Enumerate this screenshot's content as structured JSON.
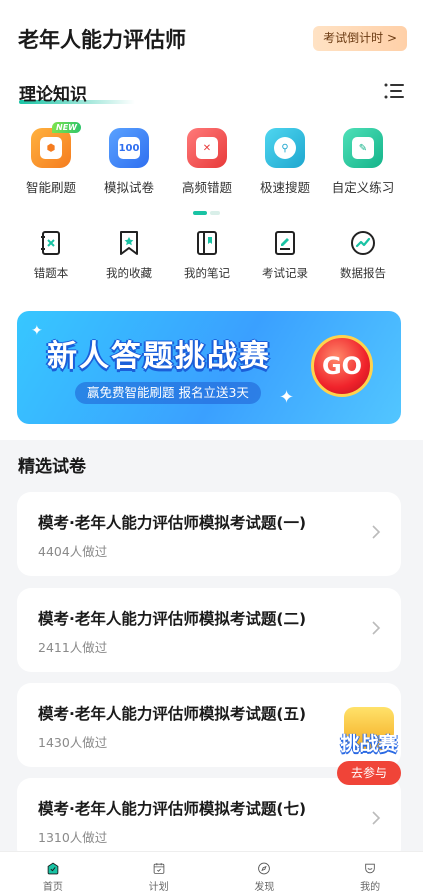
{
  "header": {
    "title": "老年人能力评估师",
    "countdown_label": "考试倒计时 >"
  },
  "theory": {
    "title": "理论知识",
    "main_tools": [
      {
        "label": "智能刷题",
        "icon": "smart-practice-icon",
        "badge": "NEW",
        "color": "#f7931e"
      },
      {
        "label": "模拟试卷",
        "icon": "mock-paper-icon",
        "badge": "100",
        "color": "#3b82f6"
      },
      {
        "label": "高频错题",
        "icon": "frequent-mistakes-icon",
        "color": "#f04b4b"
      },
      {
        "label": "极速搜题",
        "icon": "quick-search-icon",
        "color": "#22b8d6"
      },
      {
        "label": "自定义练习",
        "icon": "custom-practice-icon",
        "color": "#20c29a"
      }
    ],
    "sub_tools": [
      {
        "label": "错题本",
        "icon": "mistake-book-icon"
      },
      {
        "label": "我的收藏",
        "icon": "favorites-icon"
      },
      {
        "label": "我的笔记",
        "icon": "notes-icon"
      },
      {
        "label": "考试记录",
        "icon": "exam-record-icon"
      },
      {
        "label": "数据报告",
        "icon": "data-report-icon"
      }
    ]
  },
  "banner": {
    "title": "新人答题挑战赛",
    "subtitle": "赢免费智能刷题  报名立送3天",
    "go_label": "GO"
  },
  "papers": {
    "title": "精选试卷",
    "items": [
      {
        "title": "模考·老年人能力评估师模拟考试题(一)",
        "count": "4404人做过"
      },
      {
        "title": "模考·老年人能力评估师模拟考试题(二)",
        "count": "2411人做过"
      },
      {
        "title": "模考·老年人能力评估师模拟考试题(五)",
        "count": "1430人做过"
      },
      {
        "title": "模考·老年人能力评估师模拟考试题(七)",
        "count": "1310人做过"
      }
    ]
  },
  "floating": {
    "title": "挑战赛",
    "button": "去参与"
  },
  "tabbar": [
    {
      "label": "首页",
      "icon": "home-icon",
      "active": true
    },
    {
      "label": "计划",
      "icon": "calendar-icon"
    },
    {
      "label": "发现",
      "icon": "compass-icon"
    },
    {
      "label": "我的",
      "icon": "profile-icon"
    }
  ],
  "colors": {
    "accent": "#19c3a4",
    "banner": "#3aa0ff",
    "danger": "#f04438"
  }
}
